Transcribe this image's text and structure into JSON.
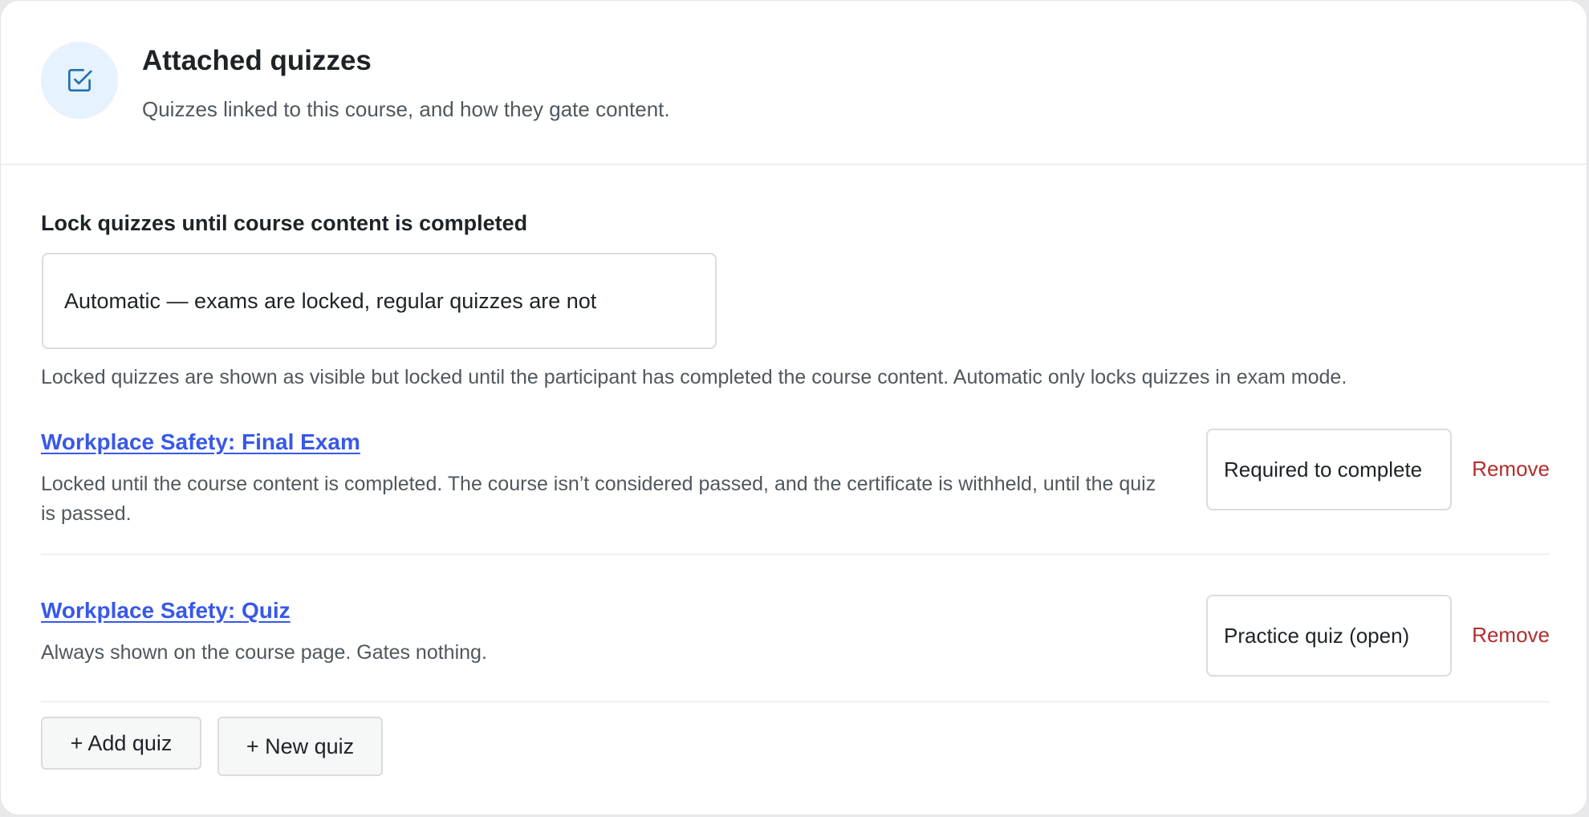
{
  "header": {
    "icon": "checkbox-icon",
    "title": "Attached quizzes",
    "subtitle": "Quizzes linked to this course, and how they gate content."
  },
  "lock_setting": {
    "label": "Lock quizzes until course content is completed",
    "selected": "Automatic — exams are locked, regular quizzes are not",
    "help": "Locked quizzes are shown as visible but locked until the participant has completed the course content. Automatic only locks quizzes in exam mode."
  },
  "quizzes": [
    {
      "title": "Workplace Safety: Final Exam",
      "description": "Locked until the course content is completed. The course isn’t considered passed, and the certificate is withheld, until the quiz is passed.",
      "mode": "Required to complete",
      "remove_label": "Remove"
    },
    {
      "title": "Workplace Safety: Quiz",
      "description": "Always shown on the course page. Gates nothing.",
      "mode": "Practice quiz (open)",
      "remove_label": "Remove"
    }
  ],
  "actions": {
    "add_quiz": "+ Add quiz",
    "new_quiz": "+ New quiz"
  },
  "colors": {
    "link": "#3858e9",
    "danger": "#b32d2e",
    "icon_bg": "#e6f2fd",
    "icon_stroke": "#2271b1"
  }
}
